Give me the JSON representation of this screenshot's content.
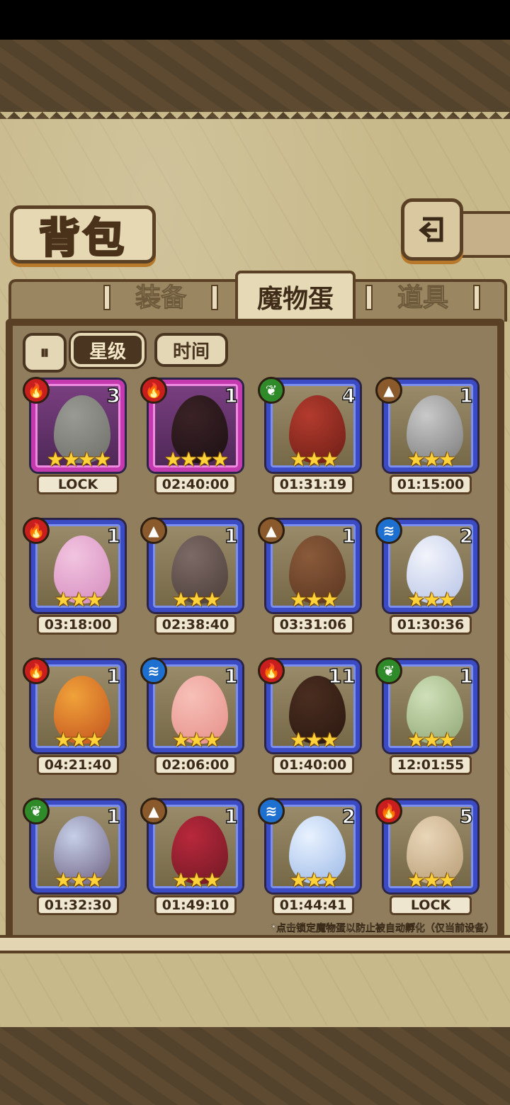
{
  "screen": {
    "title": "背包",
    "tabs": [
      {
        "label": "装备",
        "active": false
      },
      {
        "label": "魔物蛋",
        "active": true
      },
      {
        "label": "道具",
        "active": false
      }
    ],
    "sort": {
      "toggle_label": "⏸",
      "options": [
        {
          "label": "星级",
          "active": true
        },
        {
          "label": "时间",
          "active": false
        }
      ]
    },
    "eggs": [
      {
        "element": "fire",
        "count": "3",
        "stars": "★★★★",
        "timer": "LOCK"
      },
      {
        "element": "fire",
        "count": "1",
        "stars": "★★★★",
        "timer": "02:40:00"
      },
      {
        "element": "leaf",
        "count": "4",
        "stars": "★★★",
        "timer": "01:31:19"
      },
      {
        "element": "earth",
        "count": "1",
        "stars": "★★★",
        "timer": "01:15:00"
      },
      {
        "element": "fire",
        "count": "1",
        "stars": "★★★",
        "timer": "03:18:00"
      },
      {
        "element": "earth",
        "count": "1",
        "stars": "★★★",
        "timer": "02:38:40"
      },
      {
        "element": "earth",
        "count": "1",
        "stars": "★★★",
        "timer": "03:31:06"
      },
      {
        "element": "water",
        "count": "2",
        "stars": "★★★",
        "timer": "01:30:36"
      },
      {
        "element": "fire",
        "count": "1",
        "stars": "★★★",
        "timer": "04:21:40"
      },
      {
        "element": "water",
        "count": "1",
        "stars": "★★★",
        "timer": "02:06:00"
      },
      {
        "element": "fire",
        "count": "11",
        "stars": "★★★",
        "timer": "01:40:00"
      },
      {
        "element": "leaf",
        "count": "1",
        "stars": "★★★",
        "timer": "12:01:55"
      },
      {
        "element": "leaf",
        "count": "1",
        "stars": "★★★",
        "timer": "01:32:30"
      },
      {
        "element": "earth",
        "count": "1",
        "stars": "★★★",
        "timer": "01:49:10"
      },
      {
        "element": "water",
        "count": "2",
        "stars": "★★★",
        "timer": "01:44:41"
      },
      {
        "element": "fire",
        "count": "5",
        "stars": "★★★",
        "timer": "LOCK"
      }
    ],
    "footnote": "*点击锁定魔物蛋以防止被自动孵化（仅当前设备）"
  },
  "colors": {
    "frame_pink": "#c23aae",
    "frame_blue": "#3a4bc4",
    "fire": "#c81e1e",
    "leaf": "#2f8a2a",
    "earth": "#8a5a2c",
    "water": "#1d6fd0"
  }
}
